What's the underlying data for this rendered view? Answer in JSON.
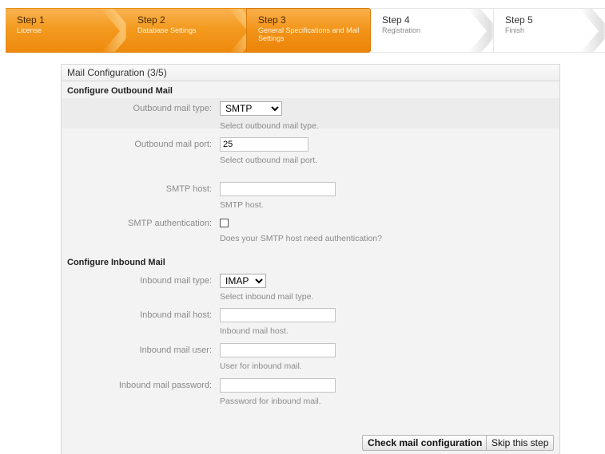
{
  "wizard": {
    "steps": [
      {
        "number": "Step 1",
        "label": "License"
      },
      {
        "number": "Step 2",
        "label": "Database Settings"
      },
      {
        "number": "Step 3",
        "label": "General Specifications and Mail Settings"
      },
      {
        "number": "Step 4",
        "label": "Registration"
      },
      {
        "number": "Step 5",
        "label": "Finish"
      }
    ],
    "current_step": 3
  },
  "panel": {
    "title": "Mail Configuration (3/5)",
    "outbound": {
      "section_title": "Configure Outbound Mail",
      "mail_type": {
        "label": "Outbound mail type:",
        "value": "SMTP",
        "hint": "Select outbound mail type."
      },
      "mail_port": {
        "label": "Outbound mail port:",
        "value": "25",
        "hint": "Select outbound mail port."
      },
      "smtp_host": {
        "label": "SMTP host:",
        "value": "",
        "hint": "SMTP host."
      },
      "smtp_auth": {
        "label": "SMTP authentication:",
        "checked": false,
        "hint": "Does your SMTP host need authentication?"
      }
    },
    "inbound": {
      "section_title": "Configure Inbound Mail",
      "mail_type": {
        "label": "Inbound mail type:",
        "value": "IMAP",
        "hint": "Select inbound mail type."
      },
      "mail_host": {
        "label": "Inbound mail host:",
        "value": "",
        "hint": "Inbound mail host."
      },
      "mail_user": {
        "label": "Inbound mail user:",
        "value": "",
        "hint": "User for inbound mail."
      },
      "mail_password": {
        "label": "Inbound mail password:",
        "value": "",
        "hint": "Password for inbound mail."
      }
    },
    "actions": {
      "check_label": "Check mail configuration",
      "skip_label": "Skip this step"
    }
  },
  "colors": {
    "step_done": "#f39a1f",
    "step_current": "#f29318",
    "panel_bg": "#f3f3f3"
  }
}
